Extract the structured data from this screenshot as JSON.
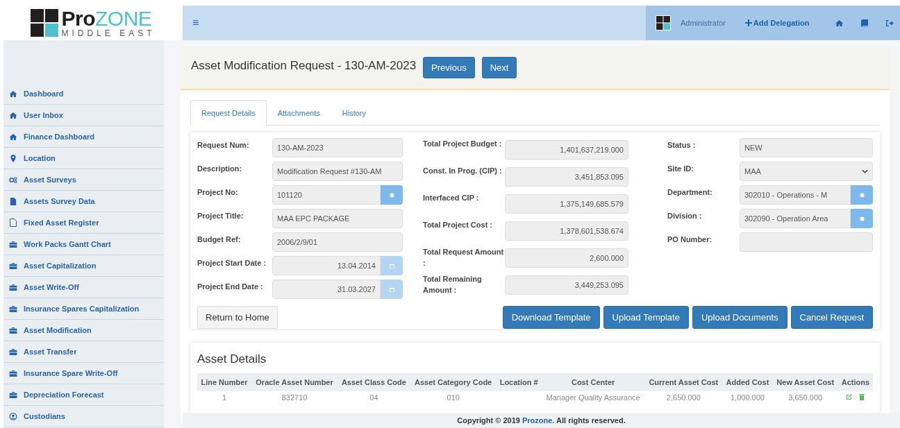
{
  "logo": {
    "brand_dark": "Pro",
    "brand_accent": "ZONE",
    "tagline": "MIDDLE EAST"
  },
  "top_bar": {
    "menu_glyph": "≡",
    "user": "Administrator",
    "add_delegation": "Add Delegation"
  },
  "sidebar": {
    "items": [
      {
        "label": "Dashboard"
      },
      {
        "label": "User Inbox"
      },
      {
        "label": "Finance Dashboard"
      },
      {
        "label": "Location"
      },
      {
        "label": "Asset Surveys"
      },
      {
        "label": "Assets Survey Data"
      },
      {
        "label": "Fixed Asset Register"
      },
      {
        "label": "Work Packs Gantt Chart"
      },
      {
        "label": "Asset Capitalization"
      },
      {
        "label": "Asset Write-Off"
      },
      {
        "label": "Insurance Spares Capitalization"
      },
      {
        "label": "Asset Modification"
      },
      {
        "label": "Asset Transfer"
      },
      {
        "label": "Insurance Spare Write-Off"
      },
      {
        "label": "Depreciation Forecast"
      },
      {
        "label": "Custodians"
      }
    ]
  },
  "page": {
    "title": "Asset Modification Request - 130-AM-2023",
    "previous": "Previous",
    "next": "Next"
  },
  "tabs": [
    {
      "label": "Request Details",
      "selected": true
    },
    {
      "label": "Attachments",
      "selected": false
    },
    {
      "label": "History",
      "selected": false
    }
  ],
  "form": {
    "columns": [
      [
        {
          "label": "Request Num:",
          "value": "130-AM-2023",
          "kind": "text"
        },
        {
          "label": "Description:",
          "value": "Modification Request #130-AM",
          "kind": "text"
        },
        {
          "label": "Project No:",
          "value": "101120",
          "kind": "lookup"
        },
        {
          "label": "Project Title:",
          "value": "MAA EPC PACKAGE",
          "kind": "text"
        },
        {
          "label": "Budget Ref:",
          "value": "2006/2/9/01",
          "kind": "text"
        },
        {
          "label": "Project Start Date :",
          "value": "13.04.2014",
          "kind": "date"
        },
        {
          "label": "Project End Date :",
          "value": "31.03.2027",
          "kind": "date"
        }
      ],
      [
        {
          "label": "Total Project Budget :",
          "value": "1,401,637,219.000",
          "kind": "amount"
        },
        {
          "label": "Const. In Prog. (CIP) :",
          "value": "3,451,853.095",
          "kind": "amount"
        },
        {
          "label": "Interfaced CIP :",
          "value": "1,375,149,685.579",
          "kind": "amount"
        },
        {
          "label": "Total Project Cost :",
          "value": "1,378,601,538.674",
          "kind": "amount"
        },
        {
          "label": "Total Request Amount :",
          "value": "2,600.000",
          "kind": "amount"
        },
        {
          "label": "Total Remaining Amount :",
          "value": "3,449,253.095",
          "kind": "amount"
        }
      ],
      [
        {
          "label": "Status :",
          "value": "NEW",
          "kind": "text"
        },
        {
          "label": "Site ID:",
          "value": "MAA",
          "kind": "select"
        },
        {
          "label": "Department:",
          "value": "302010 - Operations - M",
          "kind": "lookup"
        },
        {
          "label": "Division :",
          "value": "302090 - Operation Area",
          "kind": "lookup"
        },
        {
          "label": "PO Number:",
          "kind": "text"
        }
      ]
    ],
    "return_button": "Return to Home",
    "actions": [
      "Download Template",
      "Upload Template",
      "Upload Documents",
      "Cancel Request"
    ]
  },
  "asset_details": {
    "title": "Asset Details",
    "columns": [
      "Line Number",
      "Oracle Asset Number",
      "Asset Class Code",
      "Asset Category Code",
      "Location #",
      "Cost Center",
      "Current Asset Cost",
      "Added Cost",
      "New Asset Cost",
      "Actions"
    ],
    "rows": [
      {
        "cells": [
          "1",
          "832710",
          "04",
          "010",
          "",
          "Manager Quality Assurance",
          "2,650.000",
          "1,000.000",
          "3,650.000"
        ]
      }
    ]
  },
  "footer": {
    "before": "Copyright © 2019 ",
    "link": "Prozone.",
    "after": " All rights reserved."
  }
}
